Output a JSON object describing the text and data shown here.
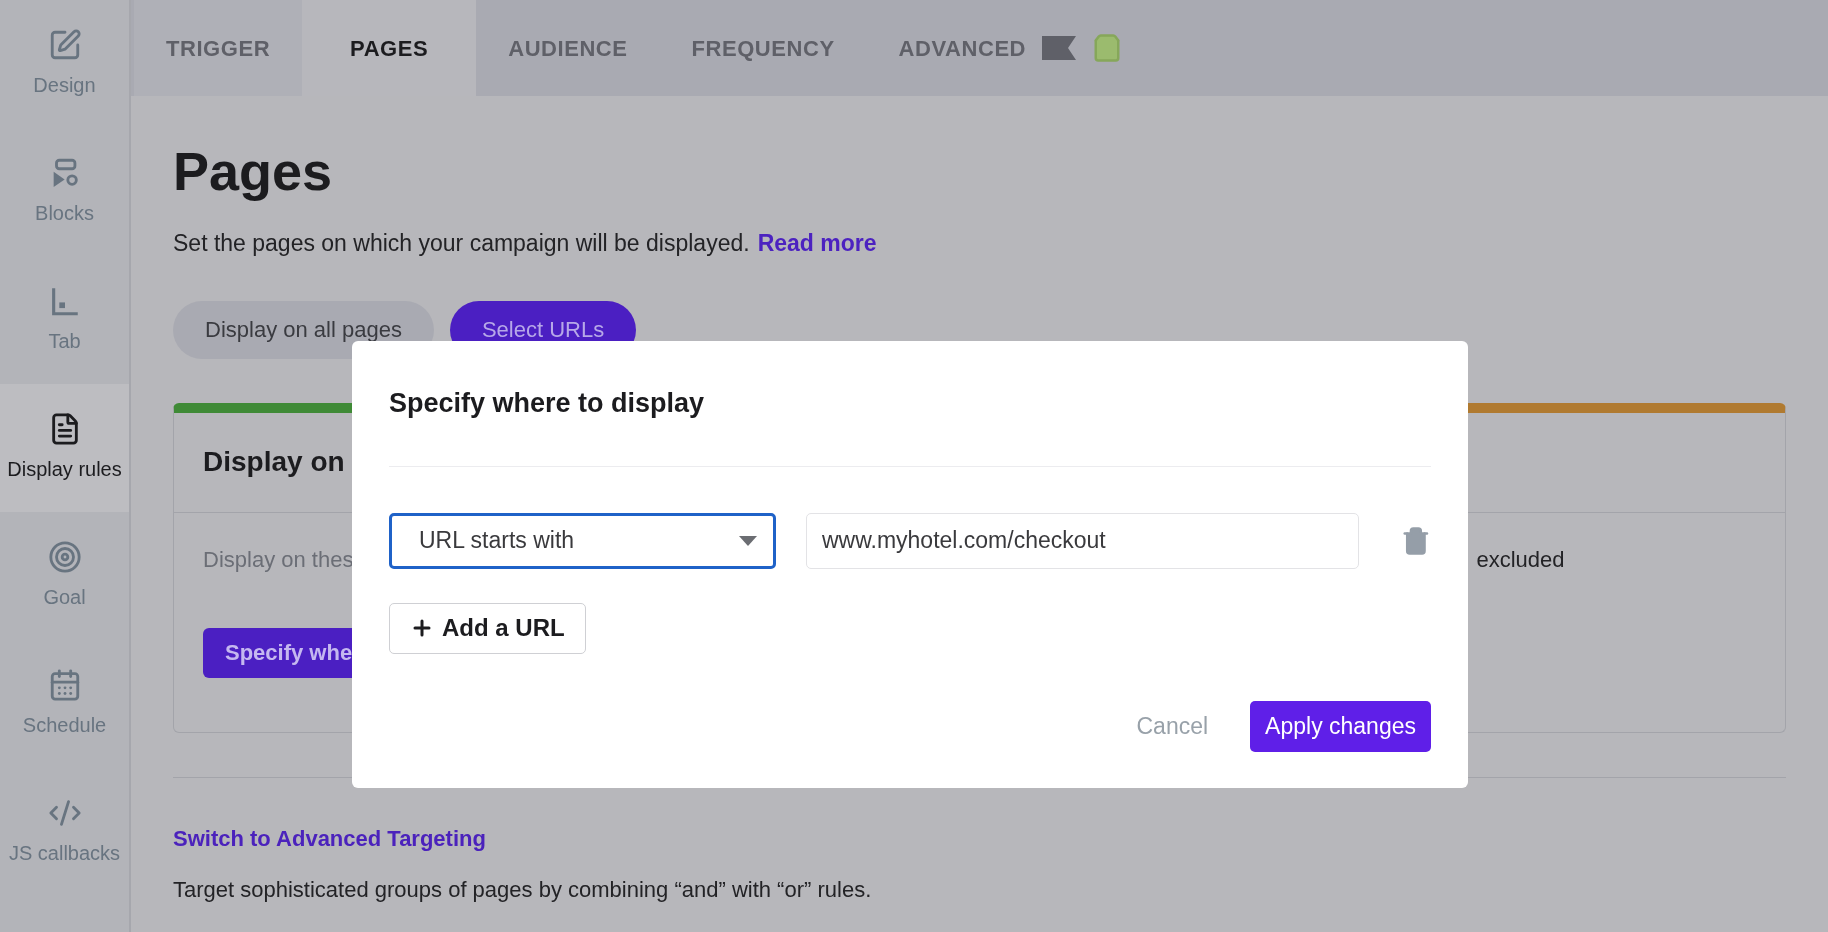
{
  "sidebar": {
    "items": [
      {
        "label": "Design",
        "selected": false
      },
      {
        "label": "Blocks",
        "selected": false
      },
      {
        "label": "Tab",
        "selected": false
      },
      {
        "label": "Display rules",
        "selected": true
      },
      {
        "label": "Goal",
        "selected": false
      },
      {
        "label": "Schedule",
        "selected": false
      },
      {
        "label": "JS callbacks",
        "selected": false
      }
    ]
  },
  "tabs": [
    {
      "label": "TRIGGER",
      "selected": false
    },
    {
      "label": "PAGES",
      "selected": true
    },
    {
      "label": "AUDIENCE",
      "selected": false
    },
    {
      "label": "FREQUENCY",
      "selected": false
    },
    {
      "label": "ADVANCED",
      "selected": false
    }
  ],
  "page": {
    "title": "Pages",
    "subtitle": "Set the pages on which your campaign will be displayed.",
    "read_more": "Read more",
    "modes": [
      {
        "label": "Display on all pages",
        "selected": false
      },
      {
        "label": "Select URLs",
        "selected": true
      }
    ],
    "include_card": {
      "heading": "Display on",
      "text": "Display on thes",
      "button": "Specify whe"
    },
    "exclude_card": {
      "text": "excluded"
    },
    "advanced_link": "Switch to Advanced Targeting",
    "advanced_text": "Target sophisticated groups of pages by combining “and” with “or” rules."
  },
  "dialog": {
    "title": "Specify where to display",
    "rules": [
      {
        "condition": "URL starts with",
        "value": "www.myhotel.com/checkout"
      }
    ],
    "add_button": "Add a URL",
    "cancel": "Cancel",
    "apply": "Apply changes"
  }
}
